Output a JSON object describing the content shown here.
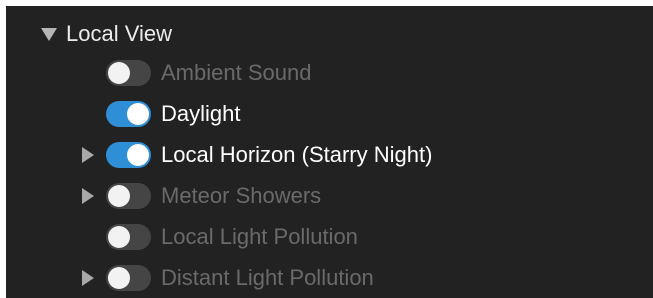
{
  "section": {
    "title": "Local View",
    "expanded": true,
    "icon": "triangle-down-icon"
  },
  "items": [
    {
      "label": "Ambient Sound",
      "enabled": false,
      "has_children": false
    },
    {
      "label": "Daylight",
      "enabled": true,
      "has_children": false
    },
    {
      "label": "Local Horizon (Starry Night)",
      "enabled": true,
      "has_children": true
    },
    {
      "label": "Meteor Showers",
      "enabled": false,
      "has_children": true
    },
    {
      "label": "Local Light Pollution",
      "enabled": false,
      "has_children": false
    },
    {
      "label": "Distant Light Pollution",
      "enabled": false,
      "has_children": true
    }
  ],
  "colors": {
    "background": "#222223",
    "toggle_on": "#2f8fd6",
    "toggle_off": "#454545",
    "label_on": "#ffffff",
    "label_off": "#6a6a6a"
  }
}
